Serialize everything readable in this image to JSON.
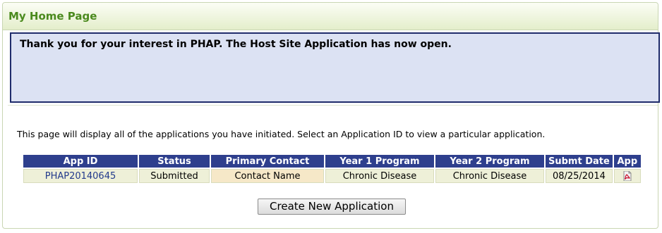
{
  "page": {
    "title": "My Home Page",
    "notice": "Thank you for your interest in PHAP. The Host Site Application has now open.",
    "intro": "This page will display all of the applications you have initiated. Select an Application ID to view a particular application."
  },
  "table": {
    "headers": [
      "App ID",
      "Status",
      "Primary Contact",
      "Year 1 Program",
      "Year 2 Program",
      "Submt Date",
      "App"
    ],
    "rows": [
      {
        "app_id": "PHAP20140645",
        "status": "Submitted",
        "primary_contact": "Contact Name",
        "year1_program": "Chronic Disease",
        "year2_program": "Chronic Disease",
        "submit_date": "08/25/2014",
        "app_icon": "pdf-icon"
      }
    ]
  },
  "actions": {
    "create_button": "Create New Application"
  },
  "colors": {
    "title_green": "#4b8a1e",
    "header_blue": "#2e3f8d",
    "notice_bg": "#dce2f3",
    "link_blue": "#223a8c"
  }
}
